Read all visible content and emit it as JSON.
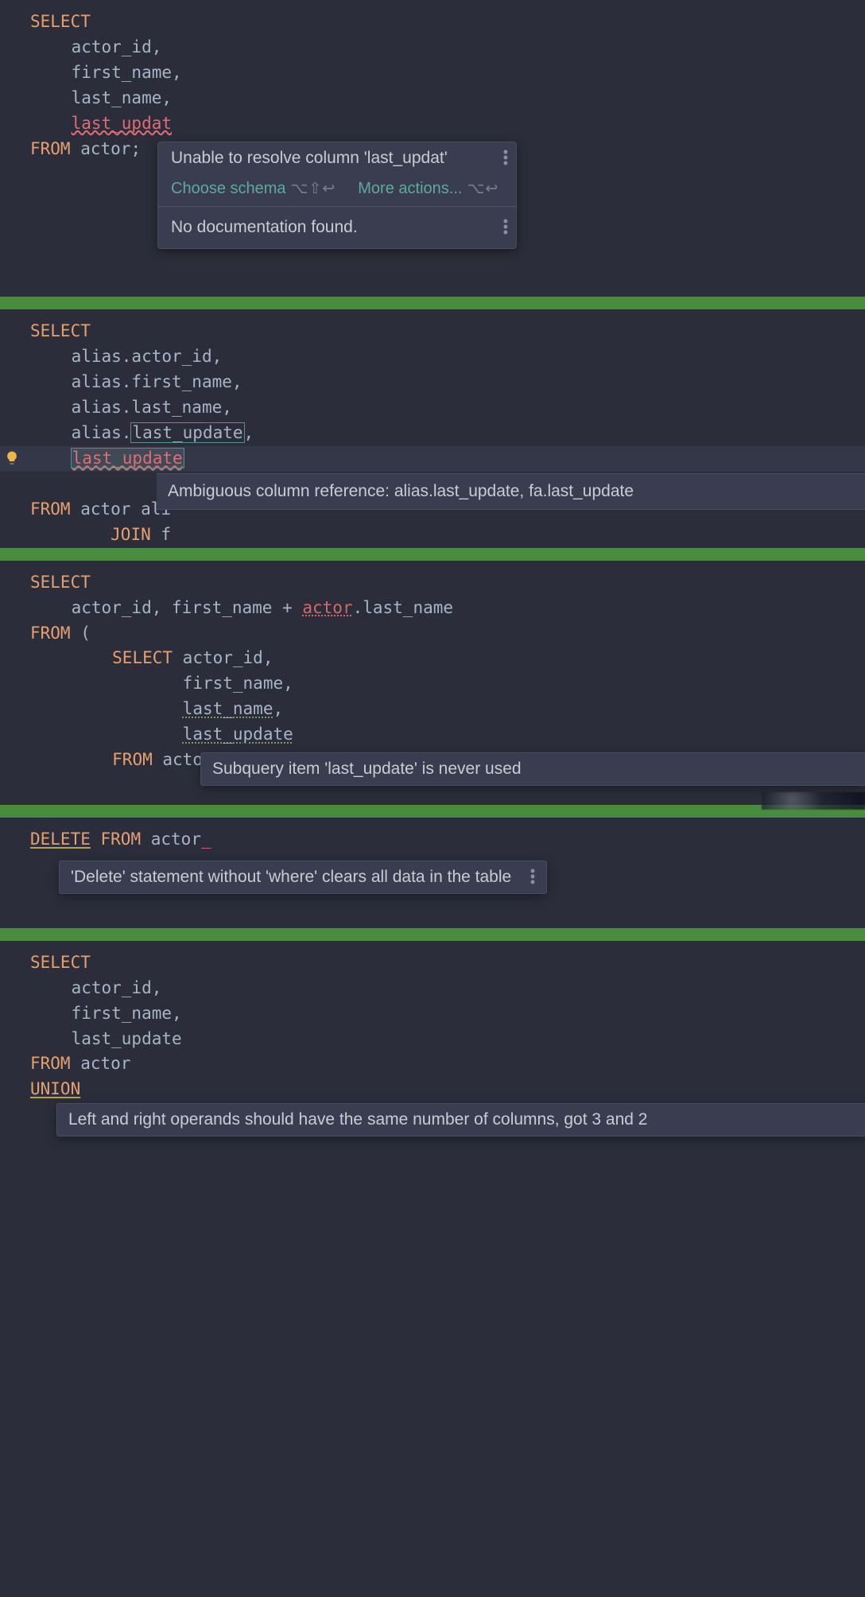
{
  "block1": {
    "code": {
      "select": "SELECT",
      "cols": [
        "actor_id,",
        "first_name,",
        "last_name,"
      ],
      "errcol": "last_updat",
      "from": "FROM",
      "table": "actor",
      "semi": ";"
    },
    "popup": {
      "title": "Unable to resolve column 'last_updat'",
      "action1": "Choose schema",
      "shortcut1": "⌥⇧↩",
      "action2": "More actions...",
      "shortcut2": "⌥↩",
      "doc": "No documentation found."
    }
  },
  "block2": {
    "code": {
      "select": "SELECT",
      "c1": "alias.actor_id,",
      "c2": "alias.first_name,",
      "c3": "alias.last_name,",
      "c4a": "alias.",
      "c4b": "last_update",
      "c4c": ",",
      "c5": "last_update",
      "from": "FROM",
      "table": "actor",
      "alias": "ali",
      "join": "JOIN",
      "jtable": "f"
    },
    "tooltip": "Ambiguous column reference: alias.last_update, fa.last_update"
  },
  "block3": {
    "code": {
      "select": "SELECT",
      "line1a": "actor_id, first_name + ",
      "line1b": "actor",
      "line1c": ".last_name",
      "from": "FROM",
      "paren": "(",
      "select2": "SELECT",
      "s1": "actor_id,",
      "s2": "first_name,",
      "s3": "last_name",
      "s3c": ",",
      "s4": "last_update",
      "from2": "FROM",
      "t2": "actor"
    },
    "tooltip": "Subquery item 'last_update' is never used"
  },
  "block4": {
    "code": {
      "delete": "DELETE",
      "from": "FROM",
      "table": "actor",
      "cursor": "_"
    },
    "tooltip": "'Delete' statement without 'where' clears all data in the table"
  },
  "block5": {
    "code": {
      "select": "SELECT",
      "c1": "actor_id,",
      "c2": "first_name,",
      "c3": "last_update",
      "from": "FROM",
      "table": "actor",
      "union": "UNION"
    },
    "tooltip": "Left and right operands should have the same number of columns, got 3 and 2"
  }
}
